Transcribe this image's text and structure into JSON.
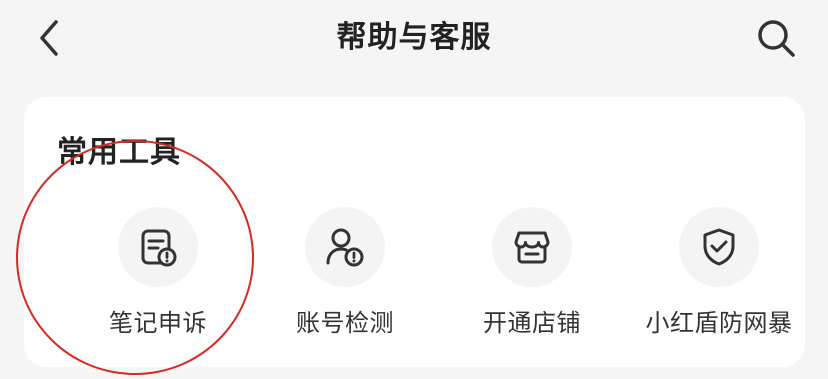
{
  "header": {
    "title": "帮助与客服",
    "back_icon": "chevron-left-icon",
    "search_icon": "search-icon"
  },
  "common_tools": {
    "title": "常用工具",
    "items": [
      {
        "label": "笔记申诉",
        "icon": "note-appeal-icon"
      },
      {
        "label": "账号检测",
        "icon": "account-check-icon"
      },
      {
        "label": "开通店铺",
        "icon": "shop-icon"
      },
      {
        "label": "小红盾防网暴",
        "icon": "shield-check-icon"
      }
    ]
  },
  "annotation": {
    "color": "#d62a22",
    "target": "笔记申诉"
  }
}
